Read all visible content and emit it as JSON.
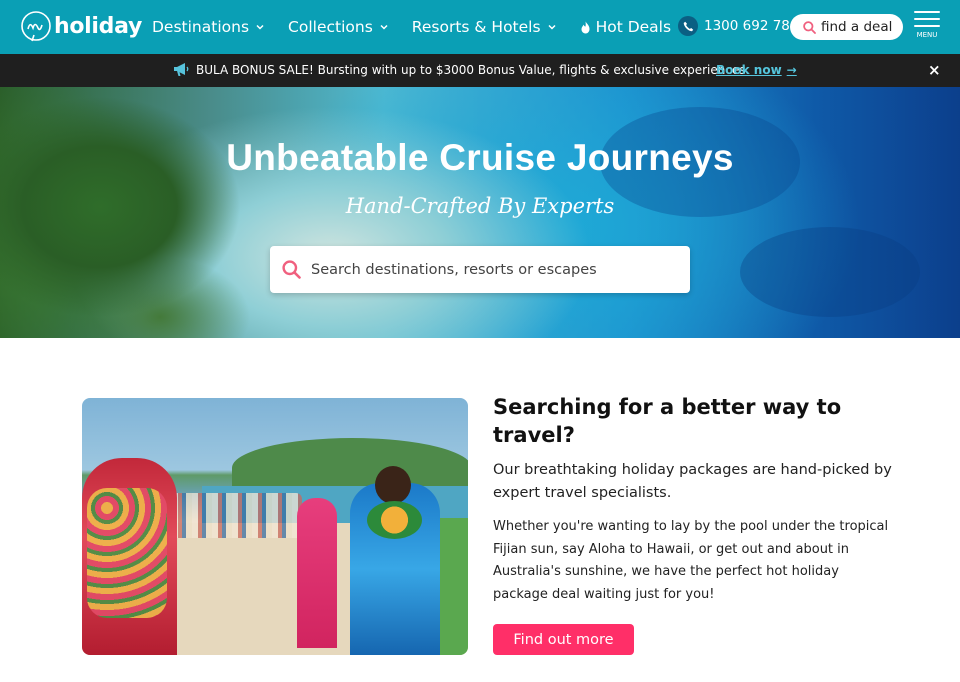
{
  "brand": {
    "logo_text": "holiday",
    "logo_script": "My"
  },
  "nav": {
    "items": [
      {
        "label": "Destinations",
        "has_dropdown": true
      },
      {
        "label": "Collections",
        "has_dropdown": true
      },
      {
        "label": "Resorts & Hotels",
        "has_dropdown": true
      },
      {
        "label": "Hot Deals",
        "has_dropdown": false,
        "icon": "flame-icon"
      }
    ],
    "phone": "1300 692 784",
    "find_deal_label": "find a deal",
    "menu_label": "MENU"
  },
  "promo": {
    "text": "BULA BONUS SALE! Bursting with up to $3000 Bonus Value, flights & exclusive experiences.",
    "link_label": "Book now",
    "close_symbol": "×"
  },
  "hero": {
    "title": "Unbeatable Cruise Journeys",
    "subtitle": "Hand-Crafted By Experts",
    "search_placeholder": "Search destinations, resorts or escapes"
  },
  "intro": {
    "heading": "Searching for a better way to travel?",
    "lead": "Our breathtaking holiday packages are hand-picked by expert travel specialists.",
    "body": "Whether you're wanting to lay by the pool under the tropical Fijian sun, say Aloha to Hawaii, or get out and about in Australia's sunshine, we have the perfect hot holiday package deal waiting just for you!",
    "cta_label": "Find out more"
  },
  "colors": {
    "nav_bg": "#0a9fb5",
    "promo_bg": "#1f1f1f",
    "accent": "#ff2f68",
    "link": "#55c5dc"
  }
}
